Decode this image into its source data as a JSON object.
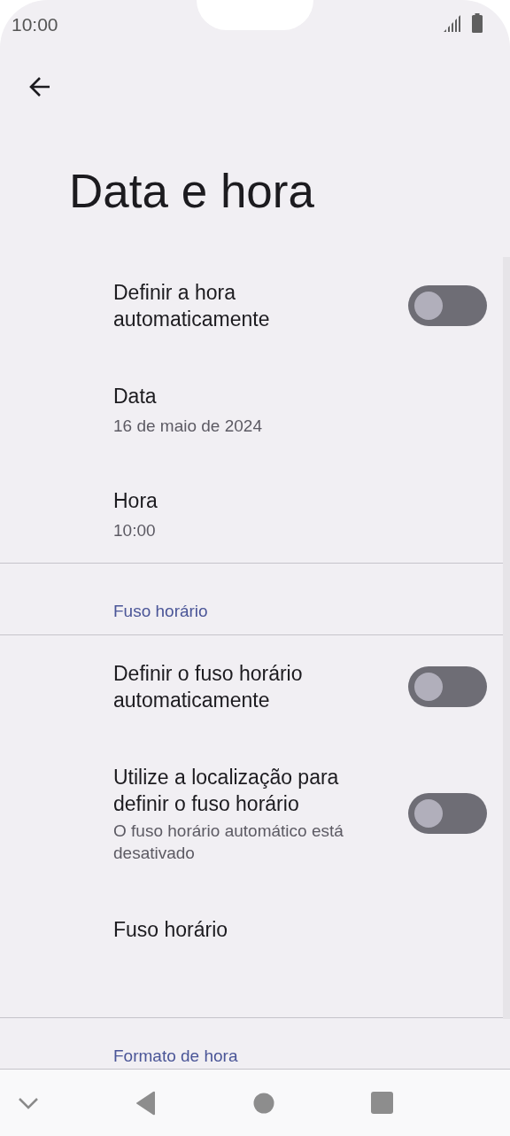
{
  "status_bar": {
    "time": "10:00"
  },
  "title": "Data e hora",
  "sections": [
    {
      "items": [
        {
          "kind": "toggle",
          "title": "Definir a hora automaticamente",
          "on": false
        },
        {
          "kind": "value",
          "title": "Data",
          "summary": "16 de maio de 2024"
        },
        {
          "kind": "value",
          "title": "Hora",
          "summary": "10:00"
        }
      ]
    },
    {
      "header": "Fuso horário",
      "items": [
        {
          "kind": "toggle",
          "title": "Definir o fuso horário automaticamente",
          "on": false
        },
        {
          "kind": "toggle",
          "title": "Utilize a localização para definir o fuso horário",
          "summary": "O fuso horário automático está desativado",
          "on": false
        },
        {
          "kind": "value",
          "title": "Fuso horário"
        }
      ]
    },
    {
      "header": "Formato de hora"
    }
  ]
}
